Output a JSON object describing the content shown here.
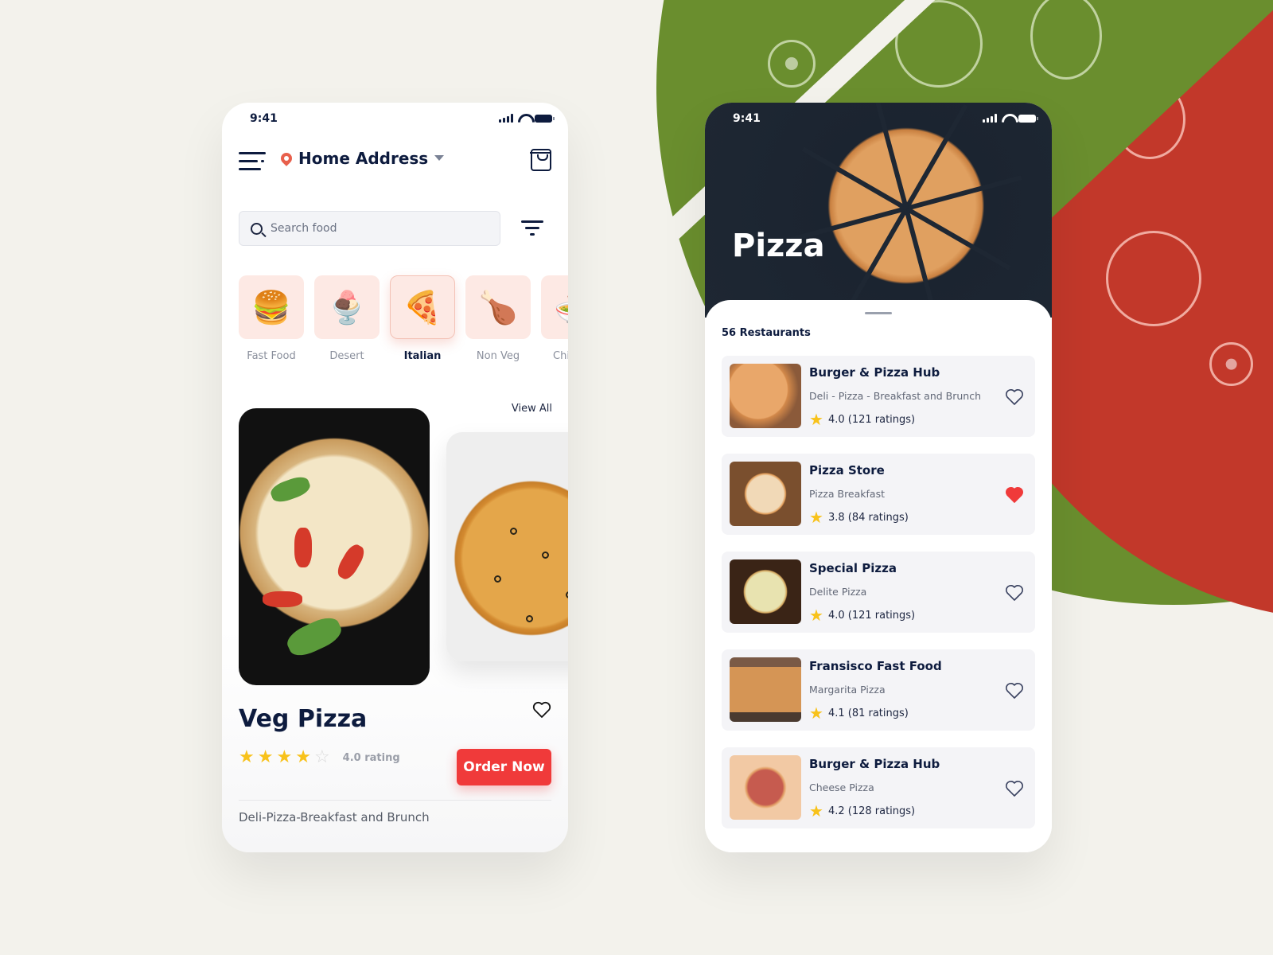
{
  "left_phone": {
    "status_time": "9:41",
    "address_label": "Home Address",
    "search_placeholder": "Search food",
    "categories": [
      {
        "label": "Fast Food",
        "icon": "🍔",
        "icon_name": "burger-drink-icon",
        "active": false
      },
      {
        "label": "Desert",
        "icon": "🍨",
        "icon_name": "dessert-cup-icon",
        "active": false
      },
      {
        "label": "Italian",
        "icon": "🍕",
        "icon_name": "pizza-icon",
        "active": true
      },
      {
        "label": "Non Veg",
        "icon": "🍗",
        "icon_name": "roast-chicken-icon",
        "active": false
      },
      {
        "label": "Chinese",
        "icon": "🍜",
        "icon_name": "noodle-bowl-icon",
        "active": false
      }
    ],
    "view_all_label": "View All",
    "dish": {
      "title": "Veg Pizza",
      "rating_value": 4,
      "rating_max": 5,
      "rating_text": "4.0 rating",
      "order_label": "Order Now",
      "description": "Deli-Pizza-Breakfast and Brunch",
      "favorited": false
    }
  },
  "right_phone": {
    "status_time": "9:41",
    "hero_title": "Pizza",
    "restaurant_count": "56 Restaurants",
    "restaurants": [
      {
        "name": "Burger & Pizza Hub",
        "subtitle": "Deli - Pizza - Breakfast and Brunch",
        "rating": "4.0 (121 ratings)",
        "favorited": false
      },
      {
        "name": "Pizza Store",
        "subtitle": "Pizza Breakfast",
        "rating": "3.8 (84 ratings)",
        "favorited": true
      },
      {
        "name": "Special Pizza",
        "subtitle": "Delite Pizza",
        "rating": "4.0 (121 ratings)",
        "favorited": false
      },
      {
        "name": "Fransisco Fast Food",
        "subtitle": "Margarita Pizza",
        "rating": "4.1 (81 ratings)",
        "favorited": false
      },
      {
        "name": "Burger & Pizza Hub",
        "subtitle": "Cheese Pizza",
        "rating": "4.2 (128 ratings)",
        "favorited": false
      }
    ]
  },
  "colors": {
    "accent_red": "#f03a3a",
    "navy_text": "#0d1b3e",
    "star_yellow": "#f8c21a",
    "category_bg": "#fde9e4",
    "background_green": "#6a8e2e",
    "background_red": "#c2382a",
    "page_bg": "#f3f2ec"
  }
}
